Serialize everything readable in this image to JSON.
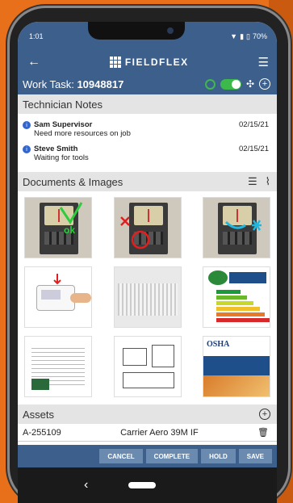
{
  "status": {
    "time": "1:01",
    "battery": "70%"
  },
  "header": {
    "brand": "FIELDFLEX",
    "back_icon": "arrow-left-icon",
    "menu_icon": "hamburger-icon"
  },
  "task": {
    "label": "Work Task:",
    "number": "10948817",
    "timer_on": true
  },
  "notes": {
    "title": "Technician Notes",
    "items": [
      {
        "name": "Sam Supervisor",
        "text": "Need more resources on job",
        "date": "02/15/21"
      },
      {
        "name": "Steve Smith",
        "text": "Waiting for tools",
        "date": "02/15/21"
      }
    ]
  },
  "documents": {
    "title": "Documents & Images"
  },
  "assets": {
    "title": "Assets",
    "items": [
      {
        "id": "A-255109",
        "name": "Carrier Aero 39M IF"
      }
    ]
  },
  "actions": {
    "cancel": "CANCEL",
    "complete": "COMPLETE",
    "hold": "HOLD",
    "save": "SAVE"
  },
  "colors": {
    "primary": "#3d5f8c",
    "accent": "#3db84b",
    "background": "#e8701a"
  }
}
